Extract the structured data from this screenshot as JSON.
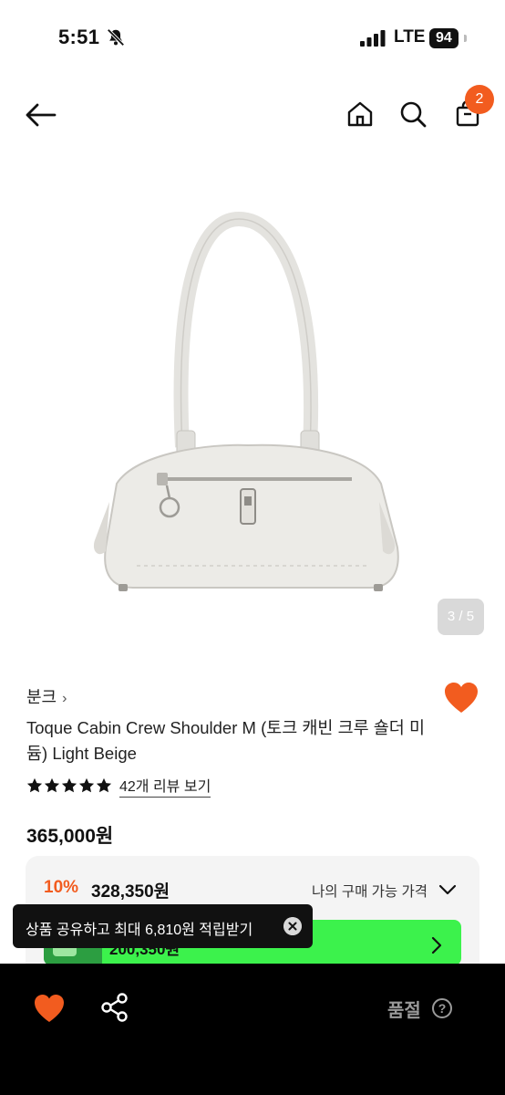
{
  "status_bar": {
    "time": "5:51",
    "network": "LTE",
    "battery": "94"
  },
  "nav": {
    "cart_count": "2"
  },
  "gallery": {
    "counter": "3 / 5"
  },
  "product": {
    "brand": "분크",
    "brand_chevron": "›",
    "title": "Toque Cabin Crew Shoulder M (토크 캐빈 크루 숄더 미듐) Light Beige",
    "rating": 5,
    "review_link": "42개 리뷰 보기",
    "original_price": "365,000원"
  },
  "price_card": {
    "discount_rate": "10%",
    "discount_price": "328,350원",
    "my_price_label": "나의 구매 가능 가격"
  },
  "banner": {
    "text": "200,350원"
  },
  "toast": {
    "text": "상품 공유하고 최대 6,810원 적립받기"
  },
  "bottom_bar": {
    "soldout_label": "품절",
    "help_glyph": "?"
  },
  "colors": {
    "accent": "#f25c1f",
    "banner_green": "#3cf24c",
    "bottom_bar": "#000000"
  }
}
